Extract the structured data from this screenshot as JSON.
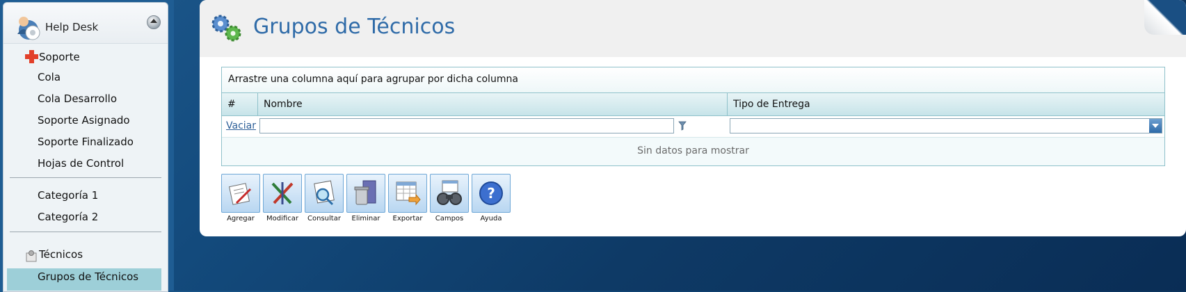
{
  "sidebar": {
    "title": "Help Desk",
    "items": [
      {
        "label": "Soporte"
      },
      {
        "label": "Cola"
      },
      {
        "label": "Cola Desarrollo"
      },
      {
        "label": "Soporte Asignado"
      },
      {
        "label": "Soporte Finalizado"
      },
      {
        "label": "Hojas de Control"
      },
      {
        "label": "Categoría 1"
      },
      {
        "label": "Categoría 2"
      },
      {
        "label": "Técnicos"
      },
      {
        "label": "Grupos de Técnicos"
      }
    ]
  },
  "page": {
    "title": "Grupos de Técnicos"
  },
  "grid": {
    "group_hint": "Arrastre una columna aquí para agrupar por dicha columna",
    "columns": [
      "#",
      "Nombre",
      "Tipo de Entrega"
    ],
    "clear_link": "Vaciar",
    "empty_text": "Sin datos para mostrar"
  },
  "toolbar": {
    "buttons": [
      {
        "label": "Agregar",
        "icon": "add-record-icon"
      },
      {
        "label": "Modificar",
        "icon": "edit-pencils-icon"
      },
      {
        "label": "Consultar",
        "icon": "magnifier-document-icon"
      },
      {
        "label": "Eliminar",
        "icon": "trash-bin-icon"
      },
      {
        "label": "Exportar",
        "icon": "spreadsheet-export-icon"
      },
      {
        "label": "Campos",
        "icon": "binoculars-icon"
      },
      {
        "label": "Ayuda",
        "icon": "help-icon"
      }
    ]
  },
  "colors": {
    "title": "#2f6ba8",
    "active_item": "#9dcfd8",
    "grid_border": "#8fc1ca"
  }
}
